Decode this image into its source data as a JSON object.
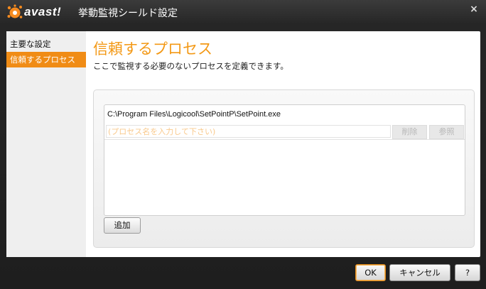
{
  "window": {
    "logo_text": "avast!",
    "title": "挙動監視シールド設定",
    "close_label": "×",
    "accent_color": "#f39814"
  },
  "sidebar": {
    "items": [
      {
        "label": "主要な設定",
        "active": false
      },
      {
        "label": "信頼するプロセス",
        "active": true
      }
    ]
  },
  "main": {
    "title": "信頼するプロセス",
    "description": "ここで監視する必要のないプロセスを定義できます。",
    "processes": [
      "C:\\Program Files\\Logicool\\SetPointP\\SetPoint.exe"
    ],
    "input": {
      "value": "",
      "placeholder": "(プロセス名を入力して下さい)"
    },
    "delete_label": "削除",
    "browse_label": "参照",
    "add_label": "追加"
  },
  "footer": {
    "ok_label": "OK",
    "cancel_label": "キャンセル",
    "help_label": "?"
  }
}
